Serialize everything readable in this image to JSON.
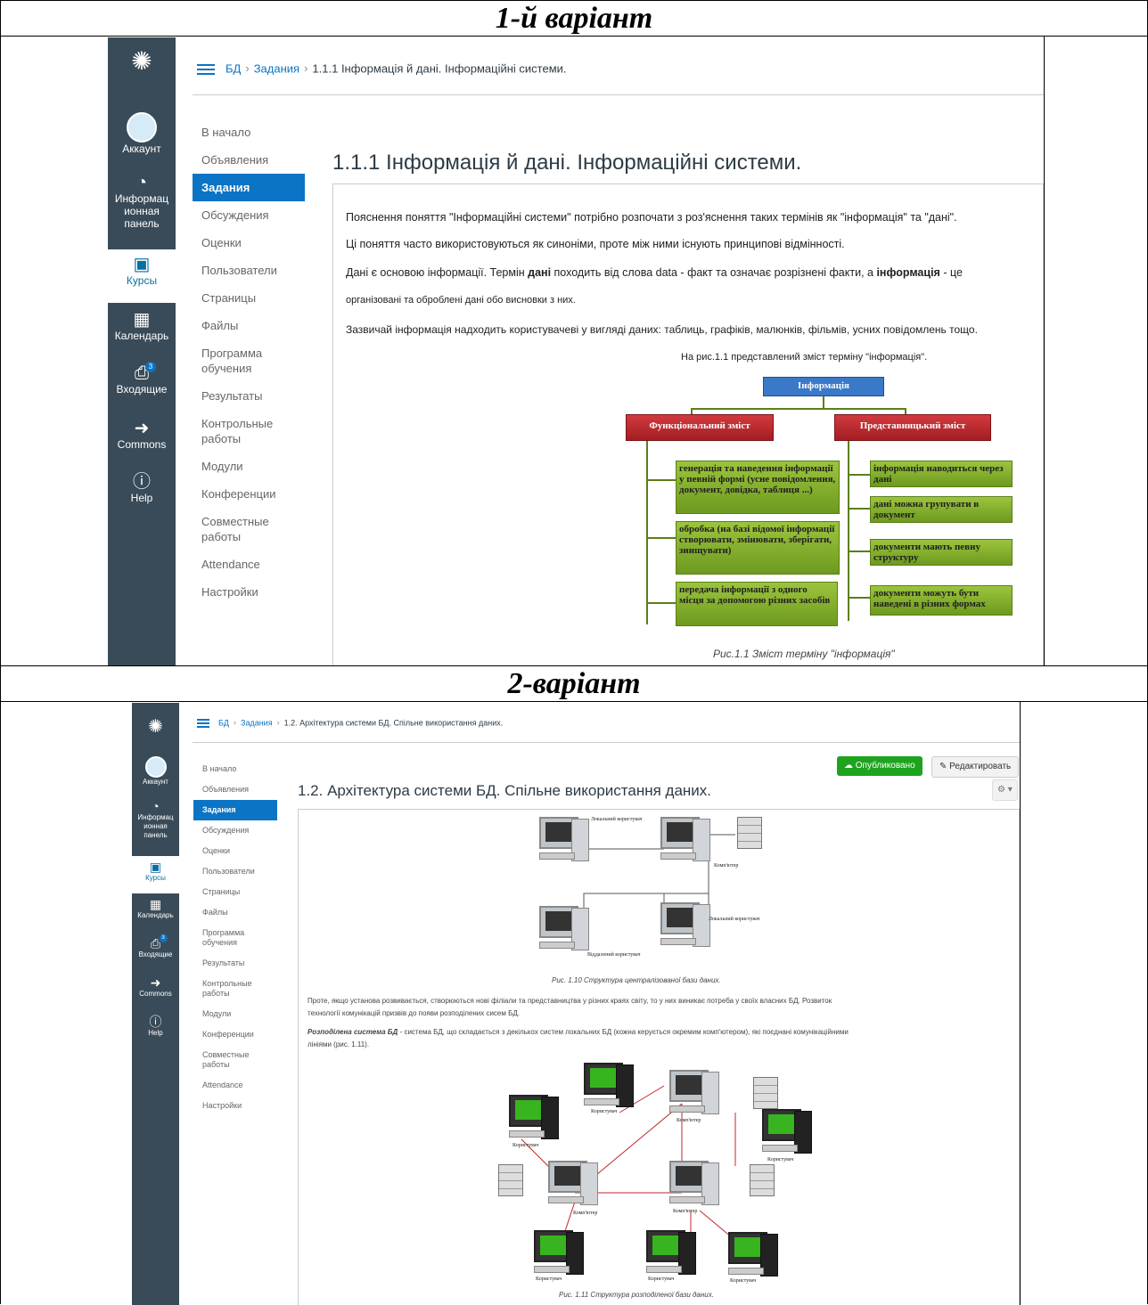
{
  "variant1": {
    "header": "1-й варіант",
    "global_nav": [
      {
        "label": "Аккаунт",
        "icon": "avatar"
      },
      {
        "label": "Информац ионная панель",
        "icon": "dashboard-icon"
      },
      {
        "label": "Курсы",
        "icon": "courses-icon",
        "active": true
      },
      {
        "label": "Календарь",
        "icon": "calendar-icon"
      },
      {
        "label": "Входящие",
        "icon": "inbox-icon",
        "badge": "3"
      },
      {
        "label": "Commons",
        "icon": "commons-icon"
      },
      {
        "label": "Help",
        "icon": "help-icon"
      }
    ],
    "breadcrumb": {
      "course": "БД",
      "section": "Задания",
      "page": "1.1.1 Інформація й дані. Інформаційні системи."
    },
    "course_nav": [
      "В начало",
      "Объявления",
      "Задания",
      "Обсуждения",
      "Оценки",
      "Пользователи",
      "Страницы",
      "Файлы",
      "Программа обучения",
      "Результаты",
      "Контрольные работы",
      "Модули",
      "Конференции",
      "Совместные работы",
      "Attendance",
      "Настройки"
    ],
    "page_title": "1.1.1 Інформація й дані. Інформаційні системи.",
    "paragraphs": {
      "p1": "Пояснення поняття \"Інформаційні системи\" потрібно розпочати з роз'яснення таких термінів як \"інформація\" та  \"дані\".",
      "p2": "Ці поняття часто використовуються як синоніми, проте між ними існують принципові відмінності.",
      "p3a": "Дані є основою інформації. Термін ",
      "p3b": "дані",
      "p3c": " походить від слова data - факт та означає розрізнені факти, а ",
      "p3d": "інформація",
      "p3e": " - це",
      "p4": "організовані та оброблені дані обо висновки з них.",
      "p5": "Зазвичай інформація надходить користувачеві у вигляді даних: таблиць, графіків, малюнків, фільмів, усних повідомлень тощо.",
      "p6": "На рис.1.1 представлений зміст терміну \"інформація\"."
    },
    "diagram": {
      "root": "Інформація",
      "left": "Функціональний зміст",
      "right": "Представницький зміст",
      "left_items": [
        "генерація та наведення інформації у певній формі (усне повідомлення, документ, довідка, таблиця ...)",
        "обробка (на базі відомої інформації створювати, змінювати, зберігати, знищувати)",
        "передача інформації з одного місця за допомогою різних засобів"
      ],
      "right_items": [
        "інформація наводиться через дані",
        "дані можна групувати в документ",
        "документи мають певну структуру",
        "документи можуть бути наведені в різних формах"
      ]
    },
    "caption": "Рис.1.1 Зміст терміну \"інформація\""
  },
  "variant2": {
    "header": "2-варіант",
    "global_nav": [
      {
        "label": "Аккаунт"
      },
      {
        "label": "Информац ионная панель"
      },
      {
        "label": "Курсы",
        "active": true
      },
      {
        "label": "Календарь"
      },
      {
        "label": "Входящие",
        "badge": "3"
      },
      {
        "label": "Commons"
      },
      {
        "label": "Help"
      }
    ],
    "breadcrumb": {
      "course": "БД",
      "section": "Задания",
      "page": "1.2. Архітектура системи БД. Спільне використання даних."
    },
    "course_nav": [
      "В начало",
      "Объявления",
      "Задания",
      "Обсуждения",
      "Оценки",
      "Пользователи",
      "Страницы",
      "Файлы",
      "Программа обучения",
      "Результаты",
      "Контрольные работы",
      "Модули",
      "Конференции",
      "Совместные работы",
      "Attendance",
      "Настройки"
    ],
    "published_button": "Опубликовано",
    "edit_button": "Редактировать",
    "page_title": "1.2. Архітектура системи БД. Спільне використання даних.",
    "figure1_labels": {
      "user_local": "Локальний користувач",
      "computer": "Комп'ютер",
      "user_remote": "Віддалений користувач"
    },
    "caption1": "Рис. 1.10 Структура централізованої бази даних.",
    "para1": "Проте, якщо установа розвивається, створюються нові філіали та представництва у різних краях світу, то у них виникає потреба у своїх власних БД. Розвиток",
    "para1b": "технології комунікацій призвів до появи розподілених сисем БД.",
    "para2_bold": "Розподілена система БД",
    "para2": " - система БД, що складається з декількох систем локальних БД (кожна керується окремим комп'ютером), які поєднані комунікаційними",
    "para2b": "лініями (рис. 1.11).",
    "figure2_labels": {
      "user": "Користувач",
      "computer": "Комп'ютер"
    },
    "caption2": "Рис. 1.11 Структура розподіленої бази даних."
  },
  "colors": {
    "nav_bg": "#394b58",
    "link": "#0b74c4",
    "publish_green": "#1ea31e",
    "diagram_red": "#c0272d",
    "diagram_blue": "#3a78c8",
    "diagram_green": "#84b22e"
  }
}
